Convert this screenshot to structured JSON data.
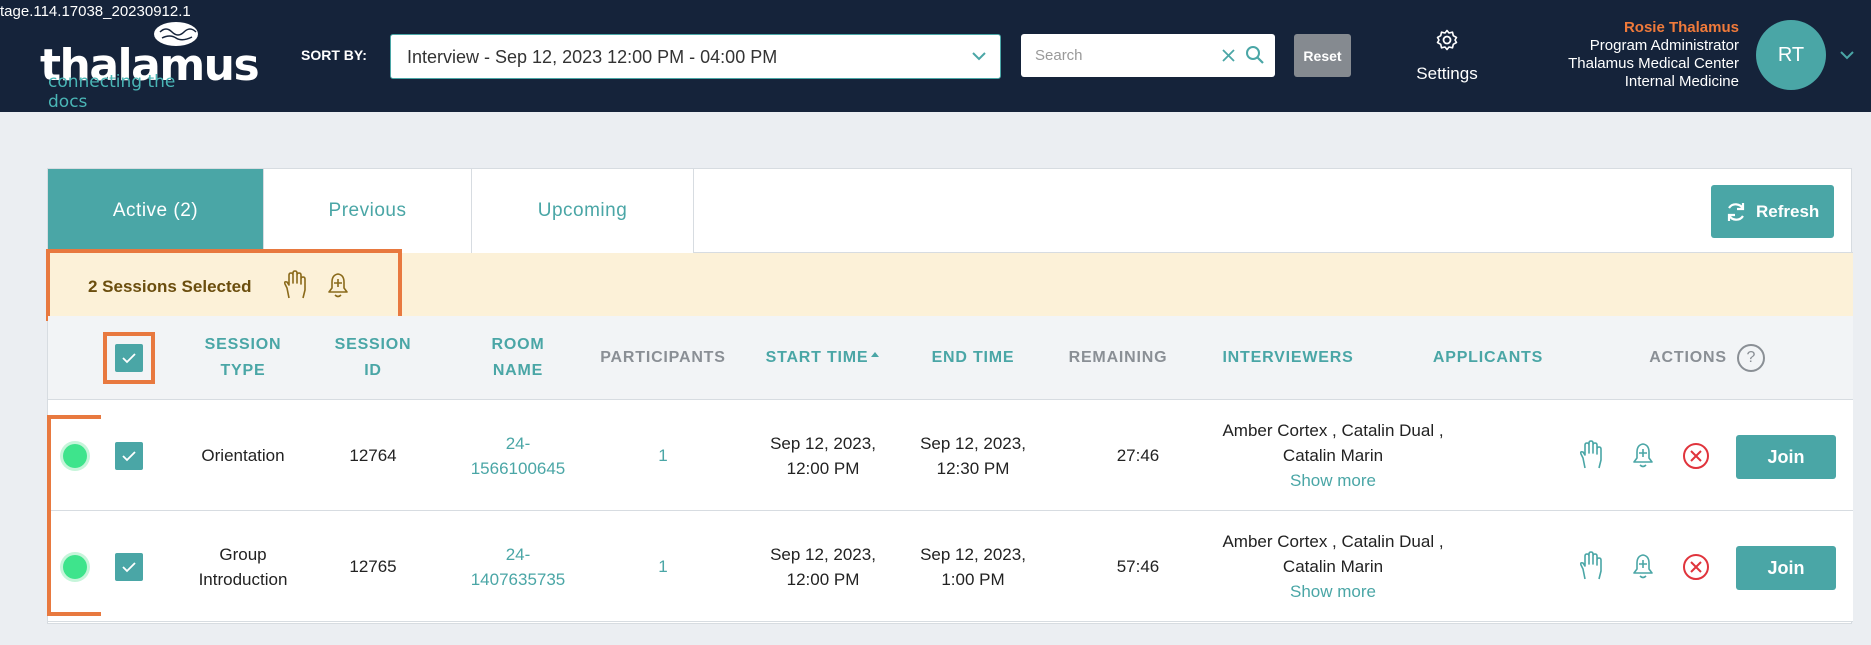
{
  "app": {
    "version": "tage.114.17038_20230912.1",
    "logo_text": "thalamus",
    "logo_tagline": "connecting the docs"
  },
  "header": {
    "sort_by_label": "SORT BY:",
    "sort_value": "Interview - Sep 12, 2023 12:00 PM - 04:00 PM",
    "search_placeholder": "Search",
    "reset_label": "Reset",
    "settings_label": "Settings",
    "user": {
      "name": "Rosie Thalamus",
      "role": "Program Administrator",
      "org": "Thalamus Medical Center",
      "dept": "Internal Medicine",
      "initials": "RT"
    }
  },
  "tabs": [
    {
      "label": "Active (2)",
      "active": true
    },
    {
      "label": "Previous",
      "active": false
    },
    {
      "label": "Upcoming",
      "active": false
    }
  ],
  "refresh_label": "Refresh",
  "selection": {
    "text": "2 Sessions Selected"
  },
  "columns": {
    "session_type": "SESSION\nTYPE",
    "session_id": "SESSION\nID",
    "room_name": "ROOM\nNAME",
    "participants": "PARTICIPANTS",
    "start_time": "START TIME",
    "end_time": "END TIME",
    "remaining": "REMAINING",
    "interviewers": "INTERVIEWERS",
    "applicants": "APPLICANTS",
    "actions": "ACTIONS"
  },
  "rows": [
    {
      "status": "active",
      "selected": true,
      "session_type": "Orientation",
      "session_id": "12764",
      "room_name": "24-\n1566100645",
      "participants": "1",
      "start_time": "Sep 12, 2023,\n12:00 PM",
      "end_time": "Sep 12, 2023,\n12:30 PM",
      "remaining": "27:46",
      "interviewers": "Amber Cortex , Catalin Dual ,\nCatalin Marin",
      "show_more": "Show more",
      "applicants": "",
      "join_label": "Join"
    },
    {
      "status": "active",
      "selected": true,
      "session_type": "Group\nIntroduction",
      "session_id": "12765",
      "room_name": "24-\n1407635735",
      "participants": "1",
      "start_time": "Sep 12, 2023,\n12:00 PM",
      "end_time": "Sep 12, 2023,\n1:00 PM",
      "remaining": "57:46",
      "interviewers": "Amber Cortex , Catalin Dual ,\nCatalin Marin",
      "show_more": "Show more",
      "applicants": "",
      "join_label": "Join"
    }
  ],
  "colors": {
    "header_bg": "#15233a",
    "accent": "#4aa6a6",
    "highlight": "#e8793f",
    "selection_bg": "#fcf1d8",
    "status_active": "#3ee48c",
    "danger": "#e0343c"
  }
}
